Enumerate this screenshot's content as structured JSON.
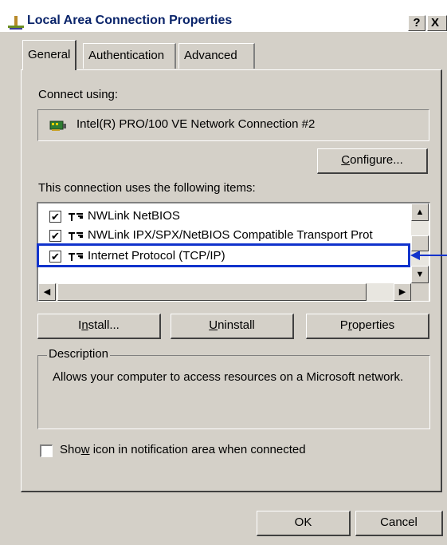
{
  "window": {
    "title": "Local Area Connection Properties",
    "help_label": "?",
    "close_label": "X"
  },
  "tabs": [
    {
      "label": "General",
      "selected": true
    },
    {
      "label": "Authentication",
      "selected": false
    },
    {
      "label": "Advanced",
      "selected": false
    }
  ],
  "connect_using": {
    "label": "Connect using:",
    "adapter": "Intel(R) PRO/100 VE Network Connection #2",
    "adapter_icon": "network-card-icon"
  },
  "buttons": {
    "configure": "Configure...",
    "install": "Install...",
    "uninstall": "Uninstall",
    "properties": "Properties",
    "ok": "OK",
    "cancel": "Cancel"
  },
  "items_label": "This connection uses the following items:",
  "items": [
    {
      "label": "NWLink NetBIOS",
      "checked": true,
      "icon": "protocol-icon"
    },
    {
      "label": "NWLink IPX/SPX/NetBIOS Compatible Transport Prot",
      "checked": true,
      "icon": "protocol-icon"
    },
    {
      "label": "Internet Protocol (TCP/IP)",
      "checked": true,
      "icon": "protocol-icon",
      "highlighted": true
    }
  ],
  "description": {
    "legend": "Description",
    "text": "Allows your computer to access resources on a Microsoft network."
  },
  "show_icon": {
    "label": "Show icon in notification area when connected",
    "checked": false
  },
  "colors": {
    "dialog_bg": "#d4d0c8",
    "title_text": "#0a246a",
    "highlight_box": "#1133cc"
  }
}
